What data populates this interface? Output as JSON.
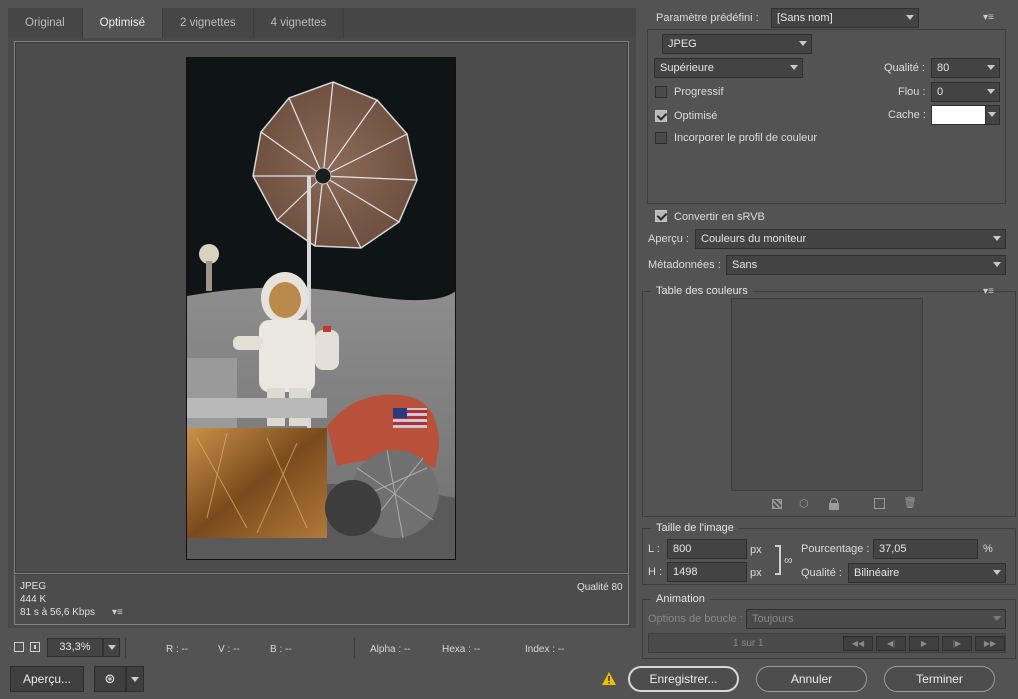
{
  "tabs": [
    {
      "label": "Original",
      "active": false
    },
    {
      "label": "Optimisé",
      "active": true
    },
    {
      "label": "2 vignettes",
      "active": false
    },
    {
      "label": "4 vignettes",
      "active": false
    }
  ],
  "preview": {
    "format": "JPEG",
    "size": "444 K",
    "speed": "81 s à 56,6 Kbps",
    "quality": "Qualité 80"
  },
  "statusbar": {
    "zoom": "33,3%",
    "r": "R : --",
    "v": "V : --",
    "b": "B : --",
    "alpha": "Alpha : --",
    "hexa": "Hexa : --",
    "index": "Index : --"
  },
  "settings": {
    "preset_label": "Paramètre prédéfini :",
    "preset_value": "[Sans nom]",
    "format_value": "JPEG",
    "quality_preset": "Supérieure",
    "quality_label": "Qualité :",
    "quality_value": "80",
    "blur_label": "Flou :",
    "blur_value": "0",
    "matte_label": "Cache :",
    "progressive_label": "Progressif",
    "progressive_checked": false,
    "optimized_label": "Optimisé",
    "optimized_checked": true,
    "embed_profile_label": "Incorporer le profil de couleur",
    "embed_profile_checked": false
  },
  "color": {
    "srgb_label": "Convertir en sRVB",
    "srgb_checked": true,
    "preview_label": "Aperçu :",
    "preview_value": "Couleurs du moniteur",
    "metadata_label": "Métadonnées :",
    "metadata_value": "Sans"
  },
  "color_table": {
    "title": "Table des couleurs"
  },
  "image_size": {
    "title": "Taille de l'image",
    "w_label": "L :",
    "w_value": "800",
    "h_label": "H :",
    "h_value": "1498",
    "unit": "px",
    "percent_label": "Pourcentage :",
    "percent_value": "37,05",
    "percent_unit": "%",
    "quality_label": "Qualité :",
    "quality_value": "Bilinéaire"
  },
  "animation": {
    "title": "Animation",
    "loop_label": "Options de boucle :",
    "loop_value": "Toujours",
    "frame_counter": "1 sur 1"
  },
  "footer": {
    "preview_button": "Aperçu...",
    "save_button": "Enregistrer...",
    "cancel_button": "Annuler",
    "done_button": "Terminer"
  },
  "colors": {
    "background": "#535353",
    "warning": "#f0c000"
  }
}
